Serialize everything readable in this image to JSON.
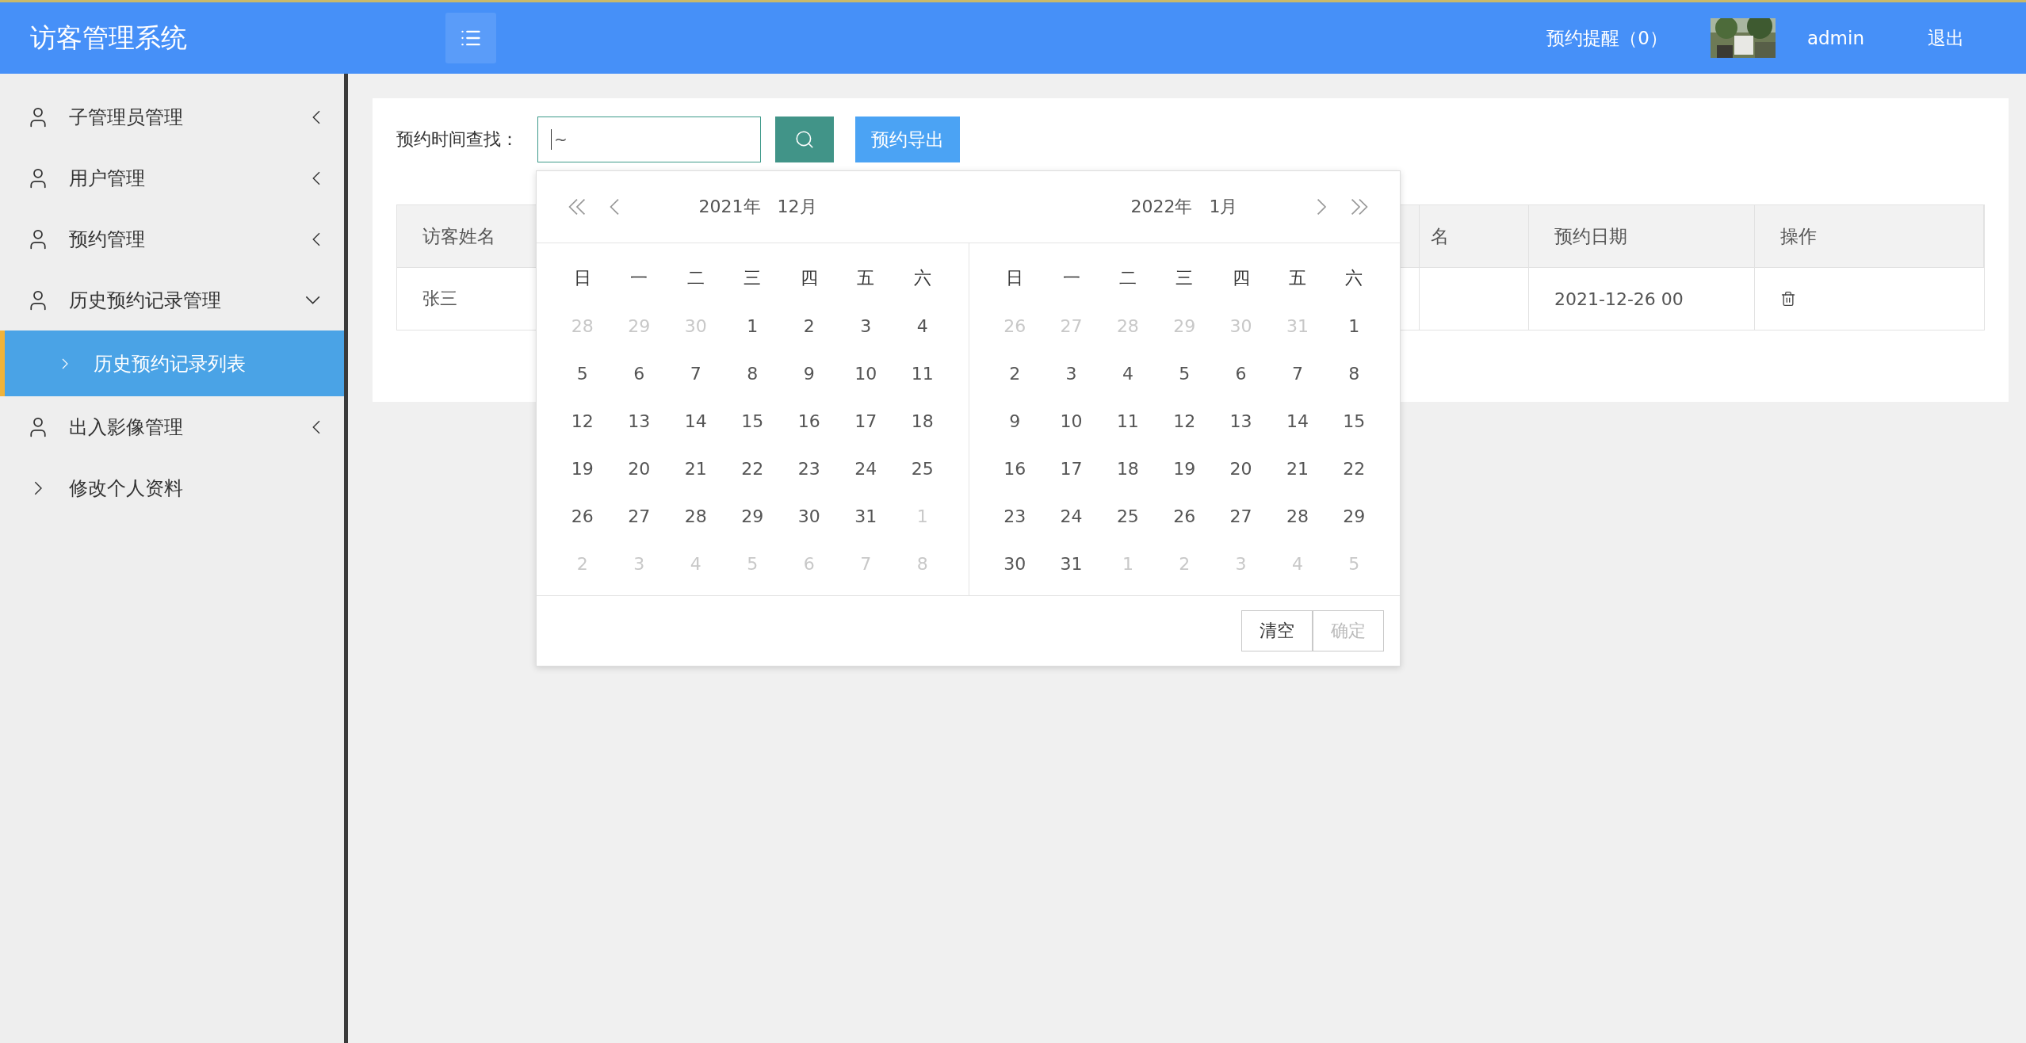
{
  "header": {
    "title": "访客管理系统",
    "reminder": "预约提醒（0）",
    "user": "admin",
    "logout": "退出"
  },
  "sidebar": {
    "items": [
      {
        "label": "子管理员管理",
        "kind": "group",
        "expanded": false,
        "selected": false
      },
      {
        "label": "用户管理",
        "kind": "group",
        "expanded": false,
        "selected": false
      },
      {
        "label": "预约管理",
        "kind": "group",
        "expanded": false,
        "selected": false
      },
      {
        "label": "历史预约记录管理",
        "kind": "group",
        "expanded": true,
        "selected": false,
        "children": [
          {
            "label": "历史预约记录列表",
            "selected": true
          }
        ]
      },
      {
        "label": "出入影像管理",
        "kind": "group",
        "expanded": false,
        "selected": false
      },
      {
        "label": "修改个人资料",
        "kind": "link",
        "selected": false
      }
    ]
  },
  "search": {
    "label": "预约时间查找：",
    "value": "~",
    "export_button": "预约导出"
  },
  "table": {
    "columns": [
      "访客姓名",
      "名",
      "预约日期",
      "操作"
    ],
    "rows": [
      {
        "visitor_name": "张三",
        "date": "2021-12-26 00"
      }
    ]
  },
  "date_picker": {
    "panels": [
      {
        "year": "2021年",
        "month": "12月",
        "weekdays": [
          "日",
          "一",
          "二",
          "三",
          "四",
          "五",
          "六"
        ],
        "days": [
          {
            "day": "28",
            "outside": true
          },
          {
            "day": "29",
            "outside": true
          },
          {
            "day": "30",
            "outside": true
          },
          {
            "day": "1",
            "outside": false
          },
          {
            "day": "2",
            "outside": false
          },
          {
            "day": "3",
            "outside": false
          },
          {
            "day": "4",
            "outside": false
          },
          {
            "day": "5",
            "outside": false
          },
          {
            "day": "6",
            "outside": false
          },
          {
            "day": "7",
            "outside": false
          },
          {
            "day": "8",
            "outside": false
          },
          {
            "day": "9",
            "outside": false
          },
          {
            "day": "10",
            "outside": false
          },
          {
            "day": "11",
            "outside": false
          },
          {
            "day": "12",
            "outside": false
          },
          {
            "day": "13",
            "outside": false
          },
          {
            "day": "14",
            "outside": false
          },
          {
            "day": "15",
            "outside": false
          },
          {
            "day": "16",
            "outside": false
          },
          {
            "day": "17",
            "outside": false
          },
          {
            "day": "18",
            "outside": false
          },
          {
            "day": "19",
            "outside": false
          },
          {
            "day": "20",
            "outside": false
          },
          {
            "day": "21",
            "outside": false
          },
          {
            "day": "22",
            "outside": false
          },
          {
            "day": "23",
            "outside": false
          },
          {
            "day": "24",
            "outside": false
          },
          {
            "day": "25",
            "outside": false
          },
          {
            "day": "26",
            "outside": false
          },
          {
            "day": "27",
            "outside": false
          },
          {
            "day": "28",
            "outside": false
          },
          {
            "day": "29",
            "outside": false
          },
          {
            "day": "30",
            "outside": false
          },
          {
            "day": "31",
            "outside": false
          },
          {
            "day": "1",
            "outside": true
          },
          {
            "day": "2",
            "outside": true
          },
          {
            "day": "3",
            "outside": true
          },
          {
            "day": "4",
            "outside": true
          },
          {
            "day": "5",
            "outside": true
          },
          {
            "day": "6",
            "outside": true
          },
          {
            "day": "7",
            "outside": true
          },
          {
            "day": "8",
            "outside": true
          }
        ]
      },
      {
        "year": "2022年",
        "month": "1月",
        "weekdays": [
          "日",
          "一",
          "二",
          "三",
          "四",
          "五",
          "六"
        ],
        "days": [
          {
            "day": "26",
            "outside": true
          },
          {
            "day": "27",
            "outside": true
          },
          {
            "day": "28",
            "outside": true
          },
          {
            "day": "29",
            "outside": true
          },
          {
            "day": "30",
            "outside": true
          },
          {
            "day": "31",
            "outside": true
          },
          {
            "day": "1",
            "outside": false
          },
          {
            "day": "2",
            "outside": false
          },
          {
            "day": "3",
            "outside": false
          },
          {
            "day": "4",
            "outside": false
          },
          {
            "day": "5",
            "outside": false
          },
          {
            "day": "6",
            "outside": false
          },
          {
            "day": "7",
            "outside": false
          },
          {
            "day": "8",
            "outside": false
          },
          {
            "day": "9",
            "outside": false
          },
          {
            "day": "10",
            "outside": false
          },
          {
            "day": "11",
            "outside": false
          },
          {
            "day": "12",
            "outside": false
          },
          {
            "day": "13",
            "outside": false
          },
          {
            "day": "14",
            "outside": false
          },
          {
            "day": "15",
            "outside": false
          },
          {
            "day": "16",
            "outside": false
          },
          {
            "day": "17",
            "outside": false
          },
          {
            "day": "18",
            "outside": false
          },
          {
            "day": "19",
            "outside": false
          },
          {
            "day": "20",
            "outside": false
          },
          {
            "day": "21",
            "outside": false
          },
          {
            "day": "22",
            "outside": false
          },
          {
            "day": "23",
            "outside": false
          },
          {
            "day": "24",
            "outside": false
          },
          {
            "day": "25",
            "outside": false
          },
          {
            "day": "26",
            "outside": false
          },
          {
            "day": "27",
            "outside": false
          },
          {
            "day": "28",
            "outside": false
          },
          {
            "day": "29",
            "outside": false
          },
          {
            "day": "30",
            "outside": false
          },
          {
            "day": "31",
            "outside": false
          },
          {
            "day": "1",
            "outside": true
          },
          {
            "day": "2",
            "outside": true
          },
          {
            "day": "3",
            "outside": true
          },
          {
            "day": "4",
            "outside": true
          },
          {
            "day": "5",
            "outside": true
          }
        ]
      }
    ],
    "buttons": [
      {
        "label": "清空",
        "disabled": false
      },
      {
        "label": "确定",
        "disabled": true
      }
    ]
  }
}
